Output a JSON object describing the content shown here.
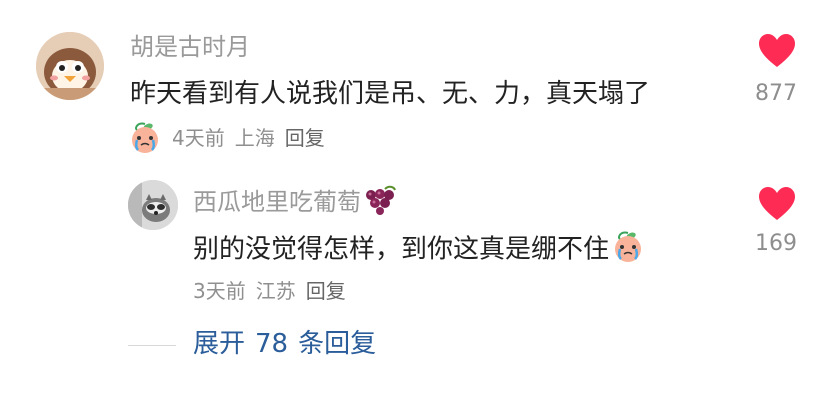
{
  "comments": [
    {
      "username": "胡是古时月",
      "text": "昨天看到有人说我们是吊、无、力，真天塌了",
      "time": "4天前",
      "location": "上海",
      "reply_label": "回复",
      "like_count": "877",
      "avatar_icon": "cartoon-sparrow-avatar",
      "meta_emoji": "crying-peach-emoji"
    },
    {
      "username": "西瓜地里吃葡萄",
      "username_emoji": "grape-emoji",
      "text": "别的没觉得怎样，到你这真是绷不住",
      "text_emoji": "crying-peach-emoji",
      "time": "3天前",
      "location": "江苏",
      "reply_label": "回复",
      "like_count": "169",
      "avatar_icon": "raccoon-photo-avatar"
    }
  ],
  "expand": {
    "prefix": "展开",
    "count": "78",
    "suffix": "条回复"
  },
  "colors": {
    "heart": "#fe2c55",
    "link": "#2a5d9a",
    "username": "#9a9a9a"
  }
}
